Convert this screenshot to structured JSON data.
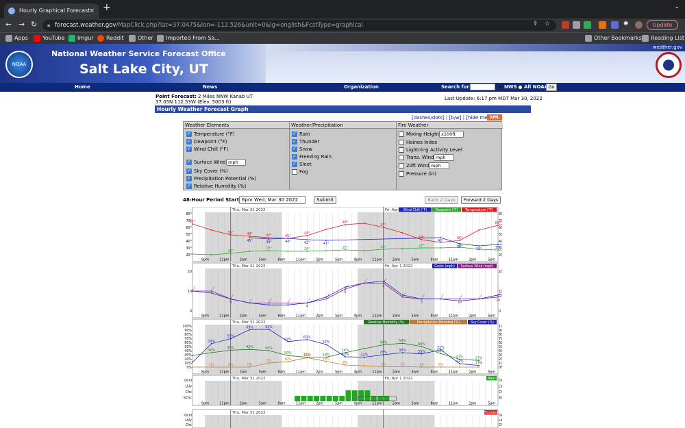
{
  "browser": {
    "tab_title": "Hourly Graphical Forecast for",
    "tab_close": "×",
    "new_tab": "+",
    "url_domain": "forecast.weather.gov",
    "url_path": "/MapClick.php?lat=37.0475&lon=-112.526&unit=0&lg=english&FcstType=graphical",
    "update_label": "Update",
    "bookmarks": [
      "Apps",
      "YouTube",
      "Imgur",
      "Reddit",
      "Other",
      "Imported From Sa..."
    ],
    "other_bookmarks": "Other Bookmarks",
    "reading_list": "Reading List"
  },
  "header": {
    "site_link": "weather.gov",
    "logo_text": "NOAA",
    "office": "National Weather Service Forecast Office",
    "city": "Salt Lake City, UT"
  },
  "nav": {
    "items": [
      "Home",
      "News",
      "Organization"
    ],
    "search_label": "Search for:",
    "radio_nws": "NWS",
    "radio_noaa": "All NOAA",
    "go": "Go"
  },
  "forecast": {
    "point_label": "Point Forecast:",
    "point_value": "2 Miles NNW Kanab UT",
    "coords": "37.05N 112.53W (Elev. 5003 ft)",
    "last_update": "Last Update: 6:17 pm MDT Mar 30, 2022",
    "bar_title": "Hourly Weather Forecast Graph",
    "links": "[dashes/dots] | [b/w] | [hide menu]",
    "xml": "XML"
  },
  "menu": {
    "headers": [
      "Weather Elements",
      "Weather/Precipitation",
      "Fire Weather"
    ],
    "col1": [
      "Temperature (°F)",
      "Dewpoint (°F)",
      "Wind Chill (°F)",
      "Surface Wind",
      "Sky Cover (%)",
      "Precipitation Potential (%)",
      "Relative Humidity (%)"
    ],
    "wind_unit": "mph",
    "col2": [
      "Rain",
      "Thunder",
      "Snow",
      "Freezing Rain",
      "Sleet",
      "Fog"
    ],
    "col3": [
      "Mixing Height",
      "Haines Index",
      "Lightning Activity Level",
      "Trans. Wind",
      "20ft Wind",
      "Pressure (in)"
    ],
    "mixing_unit": "x100ft",
    "trans_unit": "mph",
    "wind20_unit": "mph"
  },
  "controls": {
    "period_label": "48-Hour Period Starting:",
    "period_value": "6pm Wed, Mar 30 2022",
    "submit": "Submit",
    "back": "Back 2 Days",
    "forward": "Forward 2 Days"
  },
  "chart_data": {
    "type": "line",
    "day_labels": [
      "Thu, Mar 31 2022",
      "Fri, Apr 1 2022"
    ],
    "time_ticks": [
      "8pm",
      "11pm",
      "2am",
      "5am",
      "8am",
      "11am",
      "2pm",
      "5pm",
      "8pm",
      "11pm",
      "2am",
      "5am",
      "8am",
      "11am",
      "2pm",
      "5pm"
    ],
    "panel1": {
      "legend": [
        "Wind Chill (°F)",
        "Dewpoint (°F)",
        "Temperature (°F)"
      ],
      "y_ticks": [
        "80°",
        "70°",
        "60°",
        "50°",
        "40°",
        "30°",
        "20°"
      ],
      "ylim": [
        20,
        80
      ],
      "temperature": [
        65,
        56,
        49,
        47,
        45,
        44,
        48,
        57,
        64,
        66,
        60,
        52,
        42,
        38,
        41,
        56,
        63,
        70
      ],
      "temperature_labels": [
        [
          "0",
          "65°"
        ],
        [
          "2",
          "56°"
        ],
        [
          "3",
          "49°"
        ],
        [
          "4",
          "47°"
        ],
        [
          "5",
          "45°"
        ],
        [
          "6",
          "44°"
        ],
        [
          "8",
          "48°"
        ],
        [
          "10",
          "57°"
        ],
        [
          "12",
          "64°"
        ],
        [
          "14",
          "66°"
        ],
        [
          "16",
          "60°"
        ],
        [
          "18",
          "52°"
        ],
        [
          "20",
          "42°"
        ],
        [
          "22",
          "38°"
        ],
        [
          "24",
          "41°"
        ],
        [
          "26",
          "56°"
        ],
        [
          "28",
          "63°"
        ],
        [
          "30",
          "70°"
        ]
      ],
      "dewpoint": [
        21,
        20,
        22,
        25,
        26,
        25,
        25,
        26,
        27,
        26,
        28,
        29,
        30,
        30,
        31,
        28,
        27,
        26
      ],
      "dewpoint_labels": [
        [
          "2",
          "20°"
        ],
        [
          "4",
          "25°"
        ],
        [
          "6",
          "26°"
        ],
        [
          "8",
          "25°"
        ],
        [
          "10",
          "26°"
        ],
        [
          "12",
          "27°"
        ],
        [
          "14",
          "26°"
        ],
        [
          "18",
          "29°"
        ],
        [
          "20",
          "30°"
        ],
        [
          "22",
          "30°"
        ],
        [
          "24",
          "31°"
        ],
        [
          "26",
          "28°"
        ],
        [
          "28",
          "27°"
        ],
        [
          "30",
          "26°"
        ]
      ],
      "windchill": [
        45,
        43,
        44,
        42,
        41,
        45,
        36,
        33,
        35,
        38
      ],
      "windchill_labels": [
        [
          "4",
          "45°"
        ],
        [
          "6",
          "43°"
        ],
        [
          "8",
          "44°"
        ],
        [
          "10",
          "42°"
        ],
        [
          "12",
          "41°"
        ],
        [
          "20",
          "45°"
        ],
        [
          "22",
          "36°"
        ],
        [
          "24",
          "33°"
        ],
        [
          "26",
          "35°"
        ],
        [
          "28",
          "38°"
        ]
      ]
    },
    "panel2": {
      "legend": [
        "Gusts (mph)",
        "Surface Wind (mph)"
      ],
      "y_ticks": [
        "20",
        "10",
        "0"
      ],
      "ylim": [
        0,
        20
      ],
      "sustained": [
        10,
        10,
        6,
        4,
        4,
        4,
        4,
        6,
        11,
        14,
        14,
        7,
        6,
        6,
        6,
        6,
        7,
        10
      ],
      "gusts": [
        10,
        9,
        6,
        4,
        3,
        3,
        4,
        7,
        12,
        14,
        15,
        8,
        6,
        6,
        5,
        6,
        8,
        10
      ],
      "labels": [
        [
          "2",
          "6"
        ],
        [
          "6",
          "4"
        ],
        [
          "8",
          "5"
        ],
        [
          "10",
          "4"
        ],
        [
          "12",
          "5"
        ],
        [
          "14",
          "10"
        ],
        [
          "16",
          "14"
        ],
        [
          "20",
          "6"
        ],
        [
          "22",
          "6"
        ],
        [
          "24",
          "6"
        ],
        [
          "26",
          "6"
        ],
        [
          "28",
          "7"
        ]
      ]
    },
    "panel3": {
      "legend": [
        "Relative Humidity (%)",
        "Precipitation Potential (%)",
        "Sky Cover (%)"
      ],
      "y_ticks": [
        "100%",
        "90%",
        "80%",
        "70%",
        "60%",
        "50%",
        "40%",
        "30%",
        "20%",
        "10%",
        "0%"
      ],
      "ylim": [
        0,
        100
      ],
      "sky_cover": [
        12,
        57,
        69,
        91,
        92,
        62,
        67,
        55,
        25,
        24,
        30,
        35,
        32,
        42,
        8,
        4
      ],
      "sky_labels": [
        [
          "1",
          "19%"
        ],
        [
          "2",
          "59%"
        ],
        [
          "3",
          "69%"
        ],
        [
          "4",
          "91%"
        ],
        [
          "5",
          "92%"
        ],
        [
          "6",
          "60%"
        ],
        [
          "7",
          "67%"
        ],
        [
          "8",
          "63%"
        ],
        [
          "9",
          "32%"
        ],
        [
          "10",
          "25%"
        ],
        [
          "11",
          "30%"
        ],
        [
          "12",
          "35%"
        ],
        [
          "13",
          "32%"
        ],
        [
          "14",
          "42%"
        ],
        [
          "15",
          "13%"
        ]
      ],
      "humidity": [
        28,
        35,
        41,
        43,
        40,
        28,
        24,
        24,
        35,
        45,
        54,
        58,
        50,
        33,
        19,
        16
      ],
      "humidity_labels": [
        [
          "1",
          "30%"
        ],
        [
          "2",
          "36%"
        ],
        [
          "3",
          "42%"
        ],
        [
          "4",
          "50%"
        ],
        [
          "5",
          "50%"
        ],
        [
          "6",
          "32%"
        ],
        [
          "7",
          "29%"
        ],
        [
          "8",
          "24%"
        ],
        [
          "10",
          "44%"
        ],
        [
          "11",
          "54%"
        ],
        [
          "12",
          "66%"
        ],
        [
          "13",
          "52%"
        ],
        [
          "14",
          "43%"
        ],
        [
          "15",
          "22%"
        ]
      ],
      "precip": [
        0,
        0,
        0,
        0,
        10,
        13,
        23,
        14,
        5,
        3,
        1,
        1,
        0,
        0,
        0,
        0
      ],
      "precip_labels": [
        [
          "1",
          "1%"
        ],
        [
          "2",
          "0%"
        ],
        [
          "3",
          "0%"
        ],
        [
          "4",
          "0%"
        ],
        [
          "5",
          "10%"
        ],
        [
          "6",
          "13%"
        ],
        [
          "7",
          "23%"
        ],
        [
          "8",
          "8%"
        ],
        [
          "10",
          "3%"
        ],
        [
          "11",
          "1%"
        ],
        [
          "12",
          "1%"
        ],
        [
          "13",
          "0%"
        ]
      ]
    },
    "panel4": {
      "legend": [
        "Rain"
      ],
      "y_ticks": [
        "Ocnl",
        "Lkly",
        "Chc",
        "SChc"
      ],
      "rain_hours": [
        16,
        17,
        18,
        19,
        20,
        21,
        22,
        23,
        24,
        25,
        26,
        27,
        28,
        29,
        30
      ],
      "rain_chc_hours": [
        24,
        25,
        26,
        27
      ]
    },
    "panel5": {
      "legend": [
        "Thunder"
      ],
      "y_ticks": [
        "Ocnl",
        "Lkly",
        "Chc"
      ]
    },
    "colors": {
      "temperature": "#e8161b",
      "dewpoint": "#23a623",
      "windchill": "#1f1fbf",
      "wind": "#8b1a8b",
      "gusts": "#1f1fbf",
      "humidity": "#1f7a1f",
      "precip": "#c47a34",
      "sky": "#1f1fbf",
      "rain": "#23a623",
      "thunder": "#e8161b",
      "night": "#d8d8d8"
    }
  }
}
